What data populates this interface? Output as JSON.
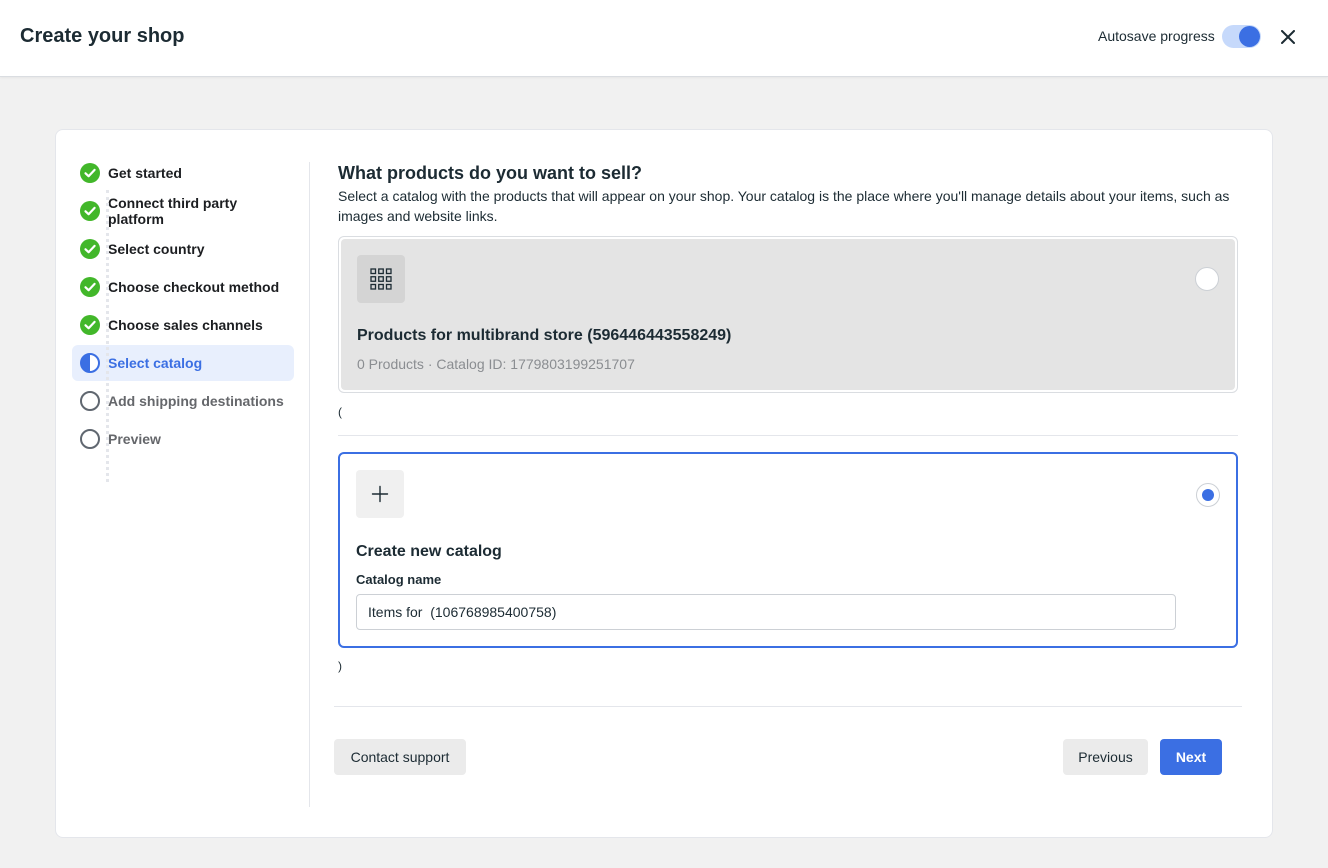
{
  "header": {
    "title": "Create your shop",
    "autosave_label": "Autosave progress",
    "autosave_on": true,
    "close_icon": "close-icon"
  },
  "steps": [
    {
      "label": "Get started",
      "status": "complete",
      "icon": "check-circle-icon"
    },
    {
      "label": "Connect third party platform",
      "status": "complete",
      "icon": "check-circle-icon"
    },
    {
      "label": "Select country",
      "status": "complete",
      "icon": "check-circle-icon"
    },
    {
      "label": "Choose checkout method",
      "status": "complete",
      "icon": "check-circle-icon"
    },
    {
      "label": "Choose sales channels",
      "status": "complete",
      "icon": "check-circle-icon"
    },
    {
      "label": "Select catalog",
      "status": "active",
      "icon": "half-circle-icon"
    },
    {
      "label": "Add shipping destinations",
      "status": "todo",
      "icon": "empty-circle-icon"
    },
    {
      "label": "Preview",
      "status": "todo",
      "icon": "empty-circle-icon"
    }
  ],
  "main": {
    "heading": "What products do you want to sell?",
    "description": "Select a catalog with the products that will appear on your shop. Your catalog is the place where you'll manage details about your items, such as images and website links.",
    "existing_catalog": {
      "name": "Products for multibrand store (596446443558249)",
      "meta": "0 Products · Catalog ID: 1779803199251707",
      "icon": "grid-icon",
      "selected": false
    },
    "open_paren": "(",
    "close_paren": ")",
    "new_catalog": {
      "title": "Create new catalog",
      "icon": "plus-icon",
      "field_label": "Catalog name",
      "field_value": "Items for  (106768985400758)",
      "selected": true
    }
  },
  "footer": {
    "support_label": "Contact support",
    "previous_label": "Previous",
    "next_label": "Next"
  },
  "colors": {
    "accent": "#3b6fe3",
    "success": "#42b72a",
    "active_bg": "#e8effd"
  }
}
